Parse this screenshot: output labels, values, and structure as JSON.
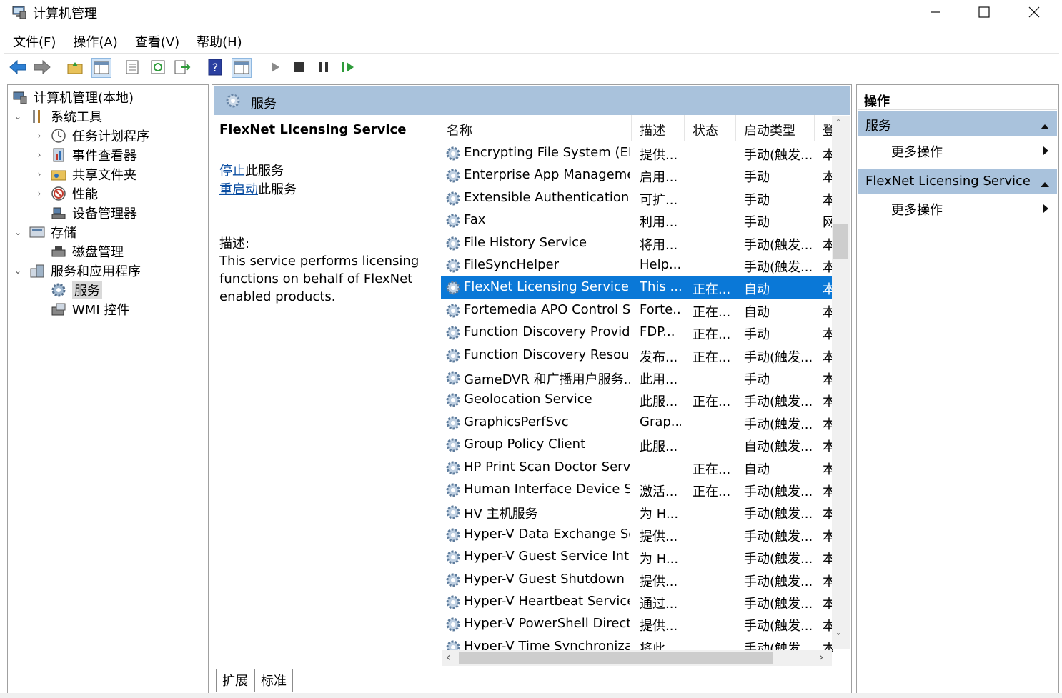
{
  "window": {
    "title": "计算机管理"
  },
  "menu": [
    "文件(F)",
    "操作(A)",
    "查看(V)",
    "帮助(H)"
  ],
  "tree": {
    "root": "计算机管理(本地)",
    "system_tools": "系统工具",
    "task_scheduler": "任务计划程序",
    "event_viewer": "事件查看器",
    "shared_folders": "共享文件夹",
    "performance": "性能",
    "device_manager": "设备管理器",
    "storage": "存储",
    "disk_management": "磁盘管理",
    "services_apps": "服务和应用程序",
    "services": "服务",
    "wmi": "WMI 控件"
  },
  "center": {
    "header": "服务",
    "selected_service": "FlexNet Licensing Service",
    "stop_link": "停止",
    "stop_suffix": "此服务",
    "restart_link": "重启动",
    "restart_suffix": "此服务",
    "desc_label": "描述:",
    "desc_text": "This service performs licensing functions on behalf of FlexNet enabled products."
  },
  "table": {
    "columns": {
      "name": "名称",
      "desc": "描述",
      "status": "状态",
      "startup": "启动类型",
      "logon": "登"
    },
    "rows": [
      {
        "name": "Encrypting File System (EFS)",
        "desc": "提供...",
        "status": "",
        "startup": "手动(触发...",
        "logon": "本"
      },
      {
        "name": "Enterprise App Manageme...",
        "desc": "启用...",
        "status": "",
        "startup": "手动",
        "logon": "本"
      },
      {
        "name": "Extensible Authentication ...",
        "desc": "可扩...",
        "status": "",
        "startup": "手动",
        "logon": "本"
      },
      {
        "name": "Fax",
        "desc": "利用...",
        "status": "",
        "startup": "手动",
        "logon": "网"
      },
      {
        "name": "File History Service",
        "desc": "将用...",
        "status": "",
        "startup": "手动(触发...",
        "logon": "本"
      },
      {
        "name": "FileSyncHelper",
        "desc": "Help...",
        "status": "",
        "startup": "手动(触发...",
        "logon": "本"
      },
      {
        "name": "FlexNet Licensing Service",
        "desc": "This ...",
        "status": "正在...",
        "startup": "自动",
        "logon": "本"
      },
      {
        "name": "Fortemedia APO Control S...",
        "desc": "Forte...",
        "status": "正在...",
        "startup": "自动",
        "logon": "本"
      },
      {
        "name": "Function Discovery Provide...",
        "desc": "FDP...",
        "status": "正在...",
        "startup": "手动",
        "logon": "本"
      },
      {
        "name": "Function Discovery Resour...",
        "desc": "发布...",
        "status": "正在...",
        "startup": "手动(触发...",
        "logon": "本"
      },
      {
        "name": "GameDVR 和广播用户服务...",
        "desc": "此用...",
        "status": "",
        "startup": "手动",
        "logon": "本"
      },
      {
        "name": "Geolocation Service",
        "desc": "此服...",
        "status": "正在...",
        "startup": "手动(触发...",
        "logon": "本"
      },
      {
        "name": "GraphicsPerfSvc",
        "desc": "Grap...",
        "status": "",
        "startup": "手动(触发...",
        "logon": "本"
      },
      {
        "name": "Group Policy Client",
        "desc": "此服...",
        "status": "",
        "startup": "自动(触发...",
        "logon": "本"
      },
      {
        "name": "HP Print Scan Doctor Service",
        "desc": "",
        "status": "正在...",
        "startup": "自动",
        "logon": "本"
      },
      {
        "name": "Human Interface Device S...",
        "desc": "激活...",
        "status": "正在...",
        "startup": "手动(触发...",
        "logon": "本"
      },
      {
        "name": "HV 主机服务",
        "desc": "为 H...",
        "status": "",
        "startup": "手动(触发...",
        "logon": "本"
      },
      {
        "name": "Hyper-V Data Exchange Se...",
        "desc": "提供...",
        "status": "",
        "startup": "手动(触发...",
        "logon": "本"
      },
      {
        "name": "Hyper-V Guest Service Int...",
        "desc": "为 H...",
        "status": "",
        "startup": "手动(触发...",
        "logon": "本"
      },
      {
        "name": "Hyper-V Guest Shutdown ...",
        "desc": "提供...",
        "status": "",
        "startup": "手动(触发...",
        "logon": "本"
      },
      {
        "name": "Hyper-V Heartbeat Service",
        "desc": "通过...",
        "status": "",
        "startup": "手动(触发...",
        "logon": "本"
      },
      {
        "name": "Hyper-V PowerShell Direct...",
        "desc": "提供...",
        "status": "",
        "startup": "手动(触发...",
        "logon": "本"
      },
      {
        "name": "Hyper-V Time Synchroniza...",
        "desc": "将此...",
        "status": "",
        "startup": "手动(触发...",
        "logon": "本"
      }
    ],
    "selected_index": 6
  },
  "tabs": [
    "扩展",
    "标准"
  ],
  "actions": {
    "header": "操作",
    "section1": "服务",
    "more1": "更多操作",
    "section2": "FlexNet Licensing Service",
    "more2": "更多操作"
  },
  "colors": {
    "header_blue": "#a9c2dc",
    "selection": "#0a78d7"
  },
  "icons": [
    "app-icon",
    "back-arrow-icon",
    "forward-arrow-icon",
    "up-folder-icon",
    "show-tree-icon",
    "properties-icon",
    "refresh-icon",
    "export-icon",
    "help-icon",
    "show-action-pane-icon",
    "play-icon",
    "stop-icon",
    "pause-icon",
    "resume-icon",
    "gear-icon"
  ]
}
